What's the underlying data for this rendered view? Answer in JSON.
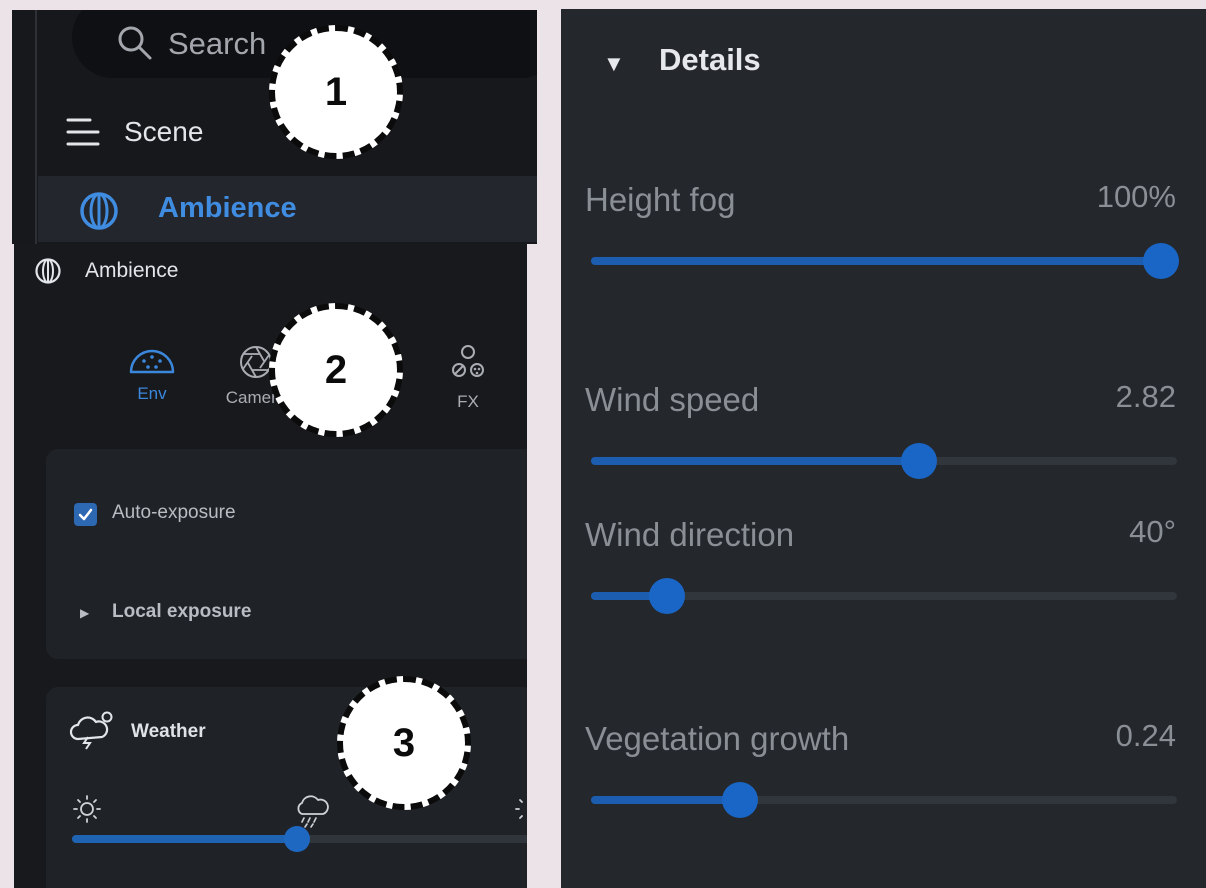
{
  "search": {
    "placeholder": "Search",
    "icon": "search-icon"
  },
  "nav": {
    "scene_label": "Scene",
    "ambience_label": "Ambience",
    "accent_color": "#3f8ce0"
  },
  "ambience_panel": {
    "title": "Ambience",
    "tabs": [
      {
        "label": "Env",
        "icon": "gauge-icon",
        "active": true
      },
      {
        "label": "Camera",
        "icon": "aperture-icon",
        "active": false
      },
      {
        "label": "FX",
        "icon": "particles-icon",
        "active": false
      }
    ],
    "exposure": {
      "auto_label": "Auto-exposure",
      "auto_checked": true,
      "local_label": "Local exposure"
    },
    "weather": {
      "title": "Weather",
      "slider_fraction": 0.49,
      "left_icon": "sun-icon",
      "middle_icon": "storm-cloud-icon",
      "right_icon": "sun-icon"
    }
  },
  "details": {
    "title": "Details",
    "sliders": [
      {
        "label": "Height fog",
        "value": "100%",
        "fraction": 1.0
      },
      {
        "label": "Wind speed",
        "value": "2.82",
        "fraction": 0.56
      },
      {
        "label": "Wind direction",
        "value": "40°",
        "fraction": 0.13
      },
      {
        "label": "Vegetation growth",
        "value": "0.24",
        "fraction": 0.255
      }
    ]
  },
  "badges": [
    "1",
    "2",
    "3"
  ]
}
